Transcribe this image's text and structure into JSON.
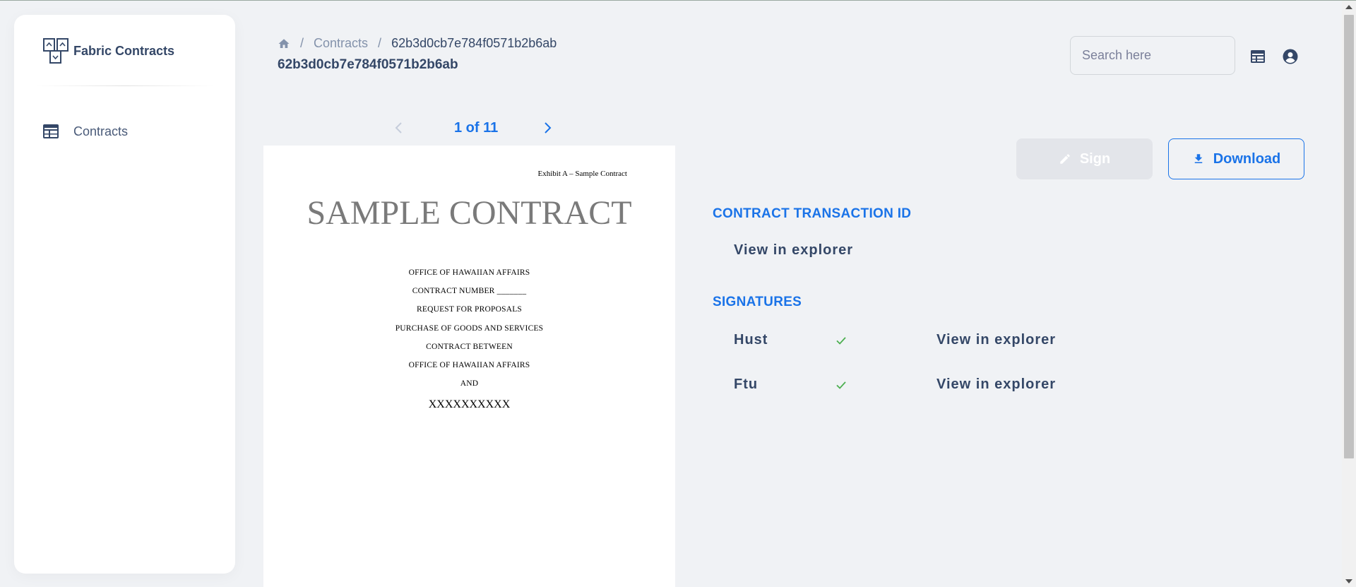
{
  "app": {
    "name": "Fabric Contracts"
  },
  "sidebar": {
    "items": [
      {
        "label": "Contracts",
        "icon": "table-icon"
      }
    ]
  },
  "breadcrumb": {
    "home_icon": "home-icon",
    "items": [
      "Contracts",
      "62b3d0cb7e784f0571b2b6ab"
    ]
  },
  "page": {
    "title": "62b3d0cb7e784f0571b2b6ab"
  },
  "search": {
    "placeholder": "Search here",
    "value": ""
  },
  "header_icons": [
    "table-view-icon",
    "account-circle-icon"
  ],
  "pager": {
    "label": "1 of 11"
  },
  "document": {
    "exhibit": "Exhibit A – Sample Contract",
    "title": "SAMPLE CONTRACT",
    "lines": [
      "OFFICE OF HAWAIIAN AFFAIRS",
      "CONTRACT NUMBER _______",
      "REQUEST FOR PROPOSALS",
      "PURCHASE OF GOODS AND SERVICES",
      "CONTRACT BETWEEN",
      "OFFICE OF HAWAIIAN AFFAIRS",
      "AND"
    ],
    "party": "XXXXXXXXXX"
  },
  "actions": {
    "sign_label": "Sign",
    "download_label": "Download"
  },
  "transaction": {
    "heading": "CONTRACT TRANSACTION ID",
    "link": "View in explorer"
  },
  "signatures": {
    "heading": "SIGNATURES",
    "rows": [
      {
        "name": "Hust",
        "signed": true,
        "link": "View in explorer"
      },
      {
        "name": "Ftu",
        "signed": true,
        "link": "View in explorer"
      }
    ]
  },
  "colors": {
    "accent": "#1a73e8",
    "text": "#344767",
    "check": "#4caf50",
    "background": "#f0f2f5"
  }
}
